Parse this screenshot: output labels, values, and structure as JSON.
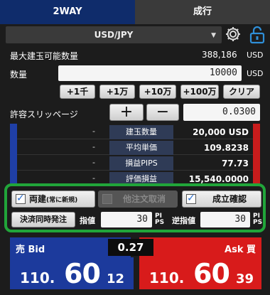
{
  "tabs": {
    "two_way": "2WAY",
    "market": "成行"
  },
  "pair": {
    "value": "USD/JPY"
  },
  "icons": {
    "settings": "gear-icon",
    "lock": "lock-icon",
    "caret": "caret-down-icon"
  },
  "max_qty": {
    "label": "最大建玉可能数量",
    "value": "388,186",
    "unit": "USD"
  },
  "qty": {
    "label": "数量",
    "value": "10000",
    "unit": "USD"
  },
  "qty_buttons": [
    "+1千",
    "+1万",
    "+10万",
    "+100万",
    "クリア"
  ],
  "slippage": {
    "label": "許容スリッページ",
    "plus": "+",
    "minus": "−",
    "value": "0.0300"
  },
  "positions": [
    {
      "left": "-",
      "label": "建玉数量",
      "value": "20,000 USD"
    },
    {
      "left": "-",
      "label": "平均単価",
      "value": "109.8238"
    },
    {
      "left": "-",
      "label": "損益PIPS",
      "value": "77.73"
    },
    {
      "left": "-",
      "label": "評価損益",
      "value": "15,540.0000"
    }
  ],
  "options": {
    "both_build": {
      "label": "両建",
      "note": "(常に新規)",
      "checked": true
    },
    "cancel_other": {
      "label": "他注文取消",
      "checked": false,
      "disabled": true
    },
    "confirm": {
      "label": "成立確認",
      "checked": true
    },
    "settle_button": "決済同時発注",
    "limit_label": "指値",
    "limit_value": "30",
    "stop_label": "逆指値",
    "stop_value": "30",
    "pips_top": "PI",
    "pips_bottom": "PS"
  },
  "bid": {
    "label": "売 Bid",
    "price_prefix": "110.",
    "price_big": "60",
    "price_pip": "12"
  },
  "ask": {
    "label": "Ask 買",
    "price_prefix": "110.",
    "price_big": "60",
    "price_pip": "39"
  },
  "spread": "0.27",
  "colors": {
    "bid": "#1c3a9c",
    "ask": "#d81b1b",
    "highlight": "#21a53a",
    "tab_active": "#0f2c6b"
  }
}
